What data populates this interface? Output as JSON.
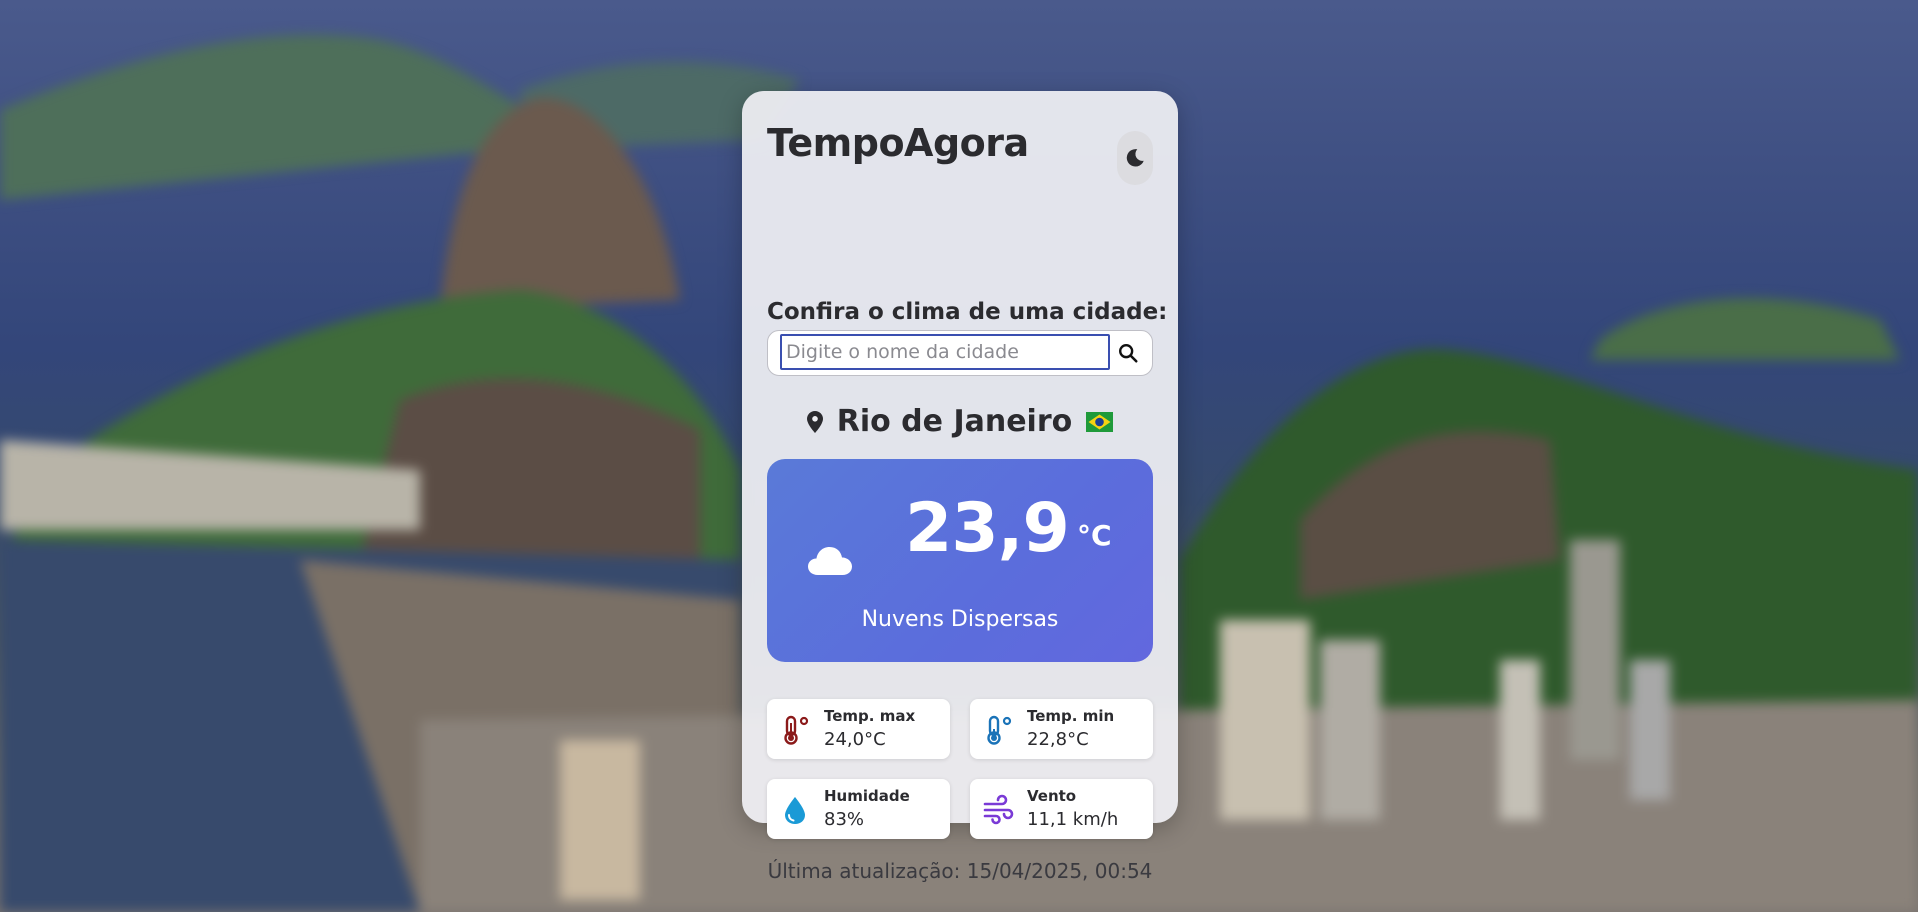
{
  "app": {
    "title": "TempoAgora",
    "theme_icon": "moon-icon"
  },
  "search": {
    "label": "Confira o clima de uma cidade:",
    "placeholder": "Digite o nome da cidade",
    "value": "",
    "button_icon": "search-icon"
  },
  "location": {
    "city": "Rio de Janeiro",
    "country_flag": "brazil-flag-icon",
    "pin_icon": "map-pin-icon"
  },
  "weather": {
    "temperature": "23,9",
    "unit": "°C",
    "description": "Nuvens Dispersas",
    "icon": "cloud-icon",
    "panel_color": "#5b73da"
  },
  "stats": {
    "max": {
      "label": "Temp. max",
      "value": "24,0°C",
      "icon": "thermometer-hot-icon",
      "color": "#8b1a1a"
    },
    "min": {
      "label": "Temp. min",
      "value": "22,8°C",
      "icon": "thermometer-cold-icon",
      "color": "#1a73b8"
    },
    "humidity": {
      "label": "Humidade",
      "value": "83%",
      "icon": "water-drop-icon",
      "color": "#1a9ad6"
    },
    "wind": {
      "label": "Vento",
      "value": "11,1 km/h",
      "icon": "wind-icon",
      "color": "#7a3ad6"
    }
  },
  "updated": "Última atualização: 15/04/2025, 00:54"
}
